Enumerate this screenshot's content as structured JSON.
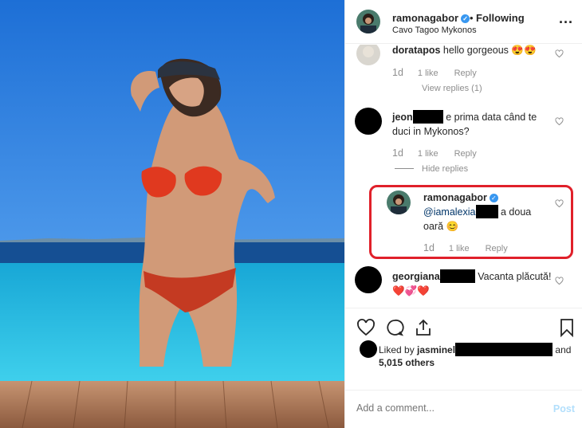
{
  "header": {
    "username": "ramonagabor",
    "dot": "•",
    "follow_status": "Following",
    "location": "Cavo Tagoo Mykonos",
    "more": "..."
  },
  "comments": [
    {
      "username": "doratapos",
      "text": "hello gorgeous 😍😍",
      "age": "1d",
      "likes": "1 like",
      "reply": "Reply",
      "view_replies": "View replies (1)"
    },
    {
      "username": "jeon",
      "text": "e prima data când te duci in Mykonos?",
      "age": "1d",
      "likes": "1 like",
      "reply": "Reply",
      "hide_replies": "Hide replies"
    },
    {
      "username": "ramonagabor",
      "mention": "@iamalexia",
      "text": "a doua oară 😊",
      "age": "1d",
      "likes": "1 like",
      "reply": "Reply"
    },
    {
      "username": "georgiana",
      "text": "Vacanta plăcută! ❤️💞❤️"
    }
  ],
  "likes_line": {
    "prefix": "Liked by ",
    "user": "jasminel",
    "and": " and",
    "count": "5,015 others"
  },
  "add_comment": {
    "placeholder": "Add a comment...",
    "post": "Post"
  },
  "colors": {
    "verified": "#3897f0",
    "highlight": "#e0202a",
    "post_disabled": "#b2dffc"
  }
}
